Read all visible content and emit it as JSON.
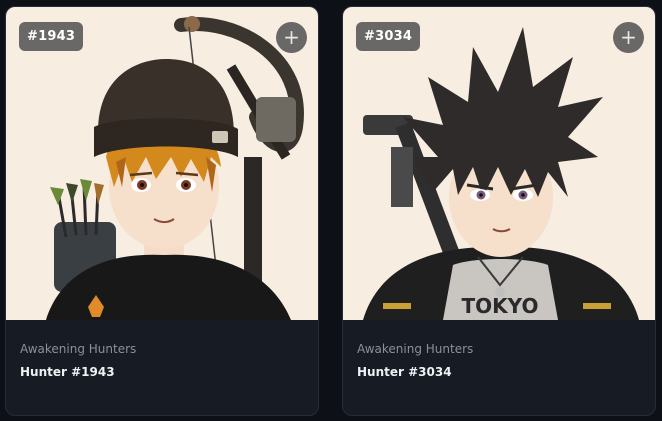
{
  "cards": [
    {
      "badge": "#1943",
      "collection": "Awakening Hunters",
      "name": "Hunter #1943",
      "add_icon": "plus-icon",
      "shirt_text": "",
      "colors": {
        "background": "#f7ede0",
        "hair": "#d4891c",
        "beanie": "#3a302a"
      }
    },
    {
      "badge": "#3034",
      "collection": "Awakening Hunters",
      "name": "Hunter #3034",
      "add_icon": "plus-icon",
      "shirt_text": "TOKYO",
      "colors": {
        "background": "#f7ede0",
        "hair": "#2e2b2a",
        "jacket": "#1f1f1f"
      }
    }
  ],
  "add_symbol": "+"
}
